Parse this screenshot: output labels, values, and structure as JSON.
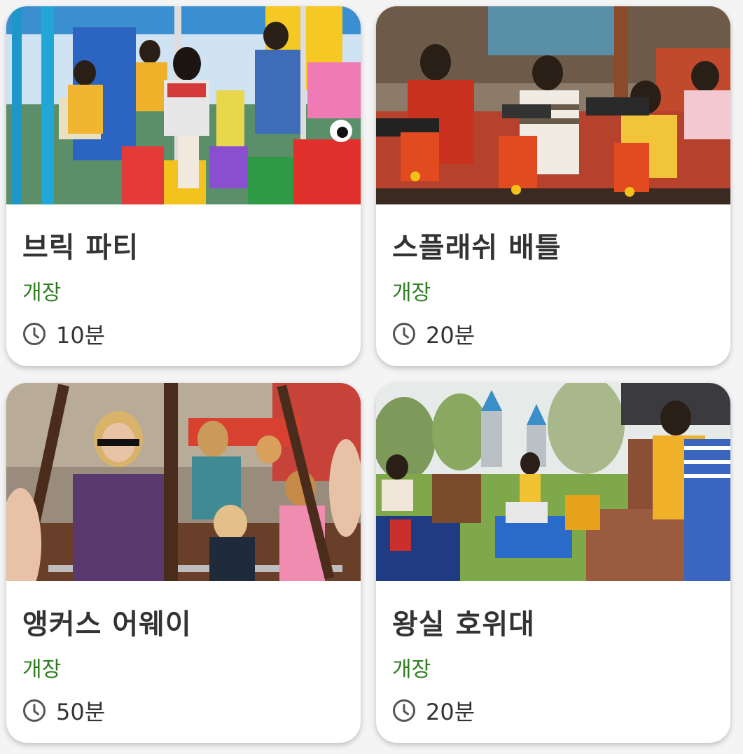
{
  "attractions": [
    {
      "name": "브릭 파티",
      "status": "개장",
      "wait": "10분"
    },
    {
      "name": "스플래쉬 배틀",
      "status": "개장",
      "wait": "20분"
    },
    {
      "name": "앵커스 어웨이",
      "status": "개장",
      "wait": "50분"
    },
    {
      "name": "왕실 호위대",
      "status": "개장",
      "wait": "20분"
    }
  ],
  "colors": {
    "status_open": "#2e7d1f",
    "title_text": "#333333",
    "card_background": "#ffffff"
  },
  "icons": {
    "wait_time": "clock-icon"
  }
}
